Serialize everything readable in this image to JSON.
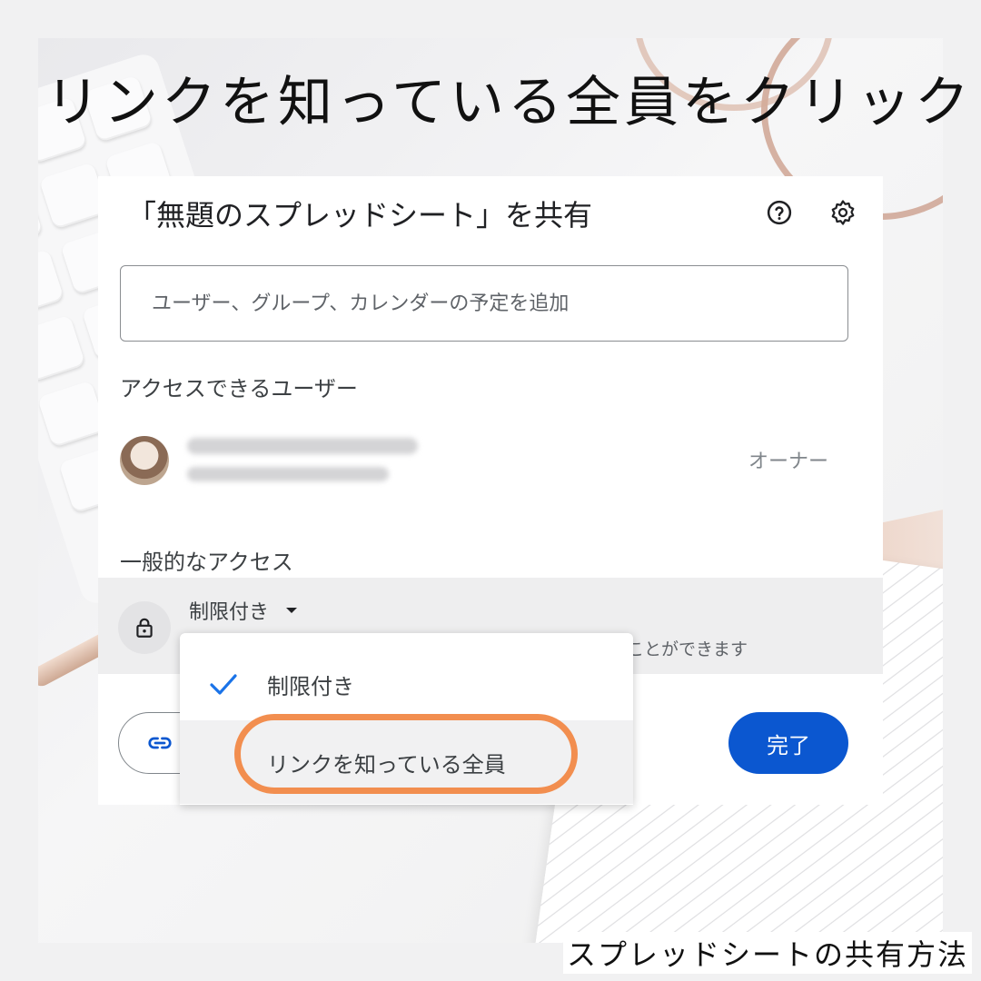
{
  "headline": "リンクを知っている全員をクリック",
  "footer_caption": "スプレッドシートの共有方法",
  "dialog": {
    "title": "「無題のスプレッドシート」を共有",
    "add_people_placeholder": "ユーザー、グループ、カレンダーの予定を追加",
    "people_section_label": "アクセスできるユーザー",
    "owner_role": "オーナー",
    "general_access_label": "一般的なアクセス",
    "access_level": "制限付き",
    "access_description_partial": "ことができます",
    "done_button": "完了"
  },
  "menu": {
    "items": [
      {
        "label": "制限付き",
        "selected": true
      },
      {
        "label": "リンクを知っている全員",
        "selected": false
      }
    ]
  },
  "colors": {
    "accent_blue": "#0b57d0",
    "highlight_orange": "#f28e4f"
  },
  "icons": [
    "help-icon",
    "settings-icon",
    "lock-icon",
    "dropdown-arrow-icon",
    "link-icon",
    "check-icon"
  ]
}
